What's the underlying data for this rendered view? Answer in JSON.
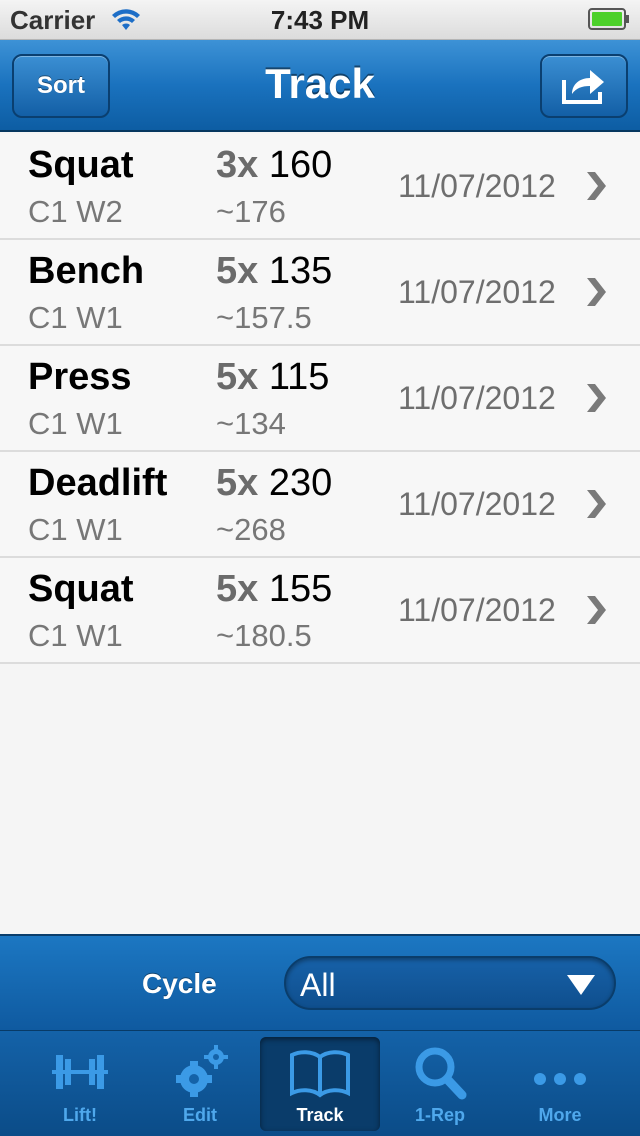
{
  "status_bar": {
    "carrier": "Carrier",
    "time": "7:43 PM"
  },
  "nav_bar": {
    "title": "Track",
    "sort_label": "Sort",
    "share_icon": "share-icon"
  },
  "entries": [
    {
      "lift": "Squat",
      "cycle_week": "C1 W2",
      "reps": "3x",
      "weight": "160",
      "estimate": "~176",
      "date": "11/07/2012"
    },
    {
      "lift": "Bench",
      "cycle_week": "C1 W1",
      "reps": "5x",
      "weight": "135",
      "estimate": "~157.5",
      "date": "11/07/2012"
    },
    {
      "lift": "Press",
      "cycle_week": "C1 W1",
      "reps": "5x",
      "weight": "115",
      "estimate": "~134",
      "date": "11/07/2012"
    },
    {
      "lift": "Deadlift",
      "cycle_week": "C1 W1",
      "reps": "5x",
      "weight": "230",
      "estimate": "~268",
      "date": "11/07/2012"
    },
    {
      "lift": "Squat",
      "cycle_week": "C1 W1",
      "reps": "5x",
      "weight": "155",
      "estimate": "~180.5",
      "date": "11/07/2012"
    }
  ],
  "cycle_filter": {
    "label": "Cycle",
    "value": "All"
  },
  "tab_bar": {
    "tabs": [
      {
        "label": "Lift!",
        "icon": "barbell-icon",
        "selected": false
      },
      {
        "label": "Edit",
        "icon": "gears-icon",
        "selected": false
      },
      {
        "label": "Track",
        "icon": "book-icon",
        "selected": true
      },
      {
        "label": "1-Rep",
        "icon": "search-icon",
        "selected": false
      },
      {
        "label": "More",
        "icon": "more-dots-icon",
        "selected": false
      }
    ]
  },
  "colors": {
    "nav_blue": "#1a72be",
    "tab_inactive": "#4fa8ec",
    "battery_green": "#4cd02a"
  }
}
